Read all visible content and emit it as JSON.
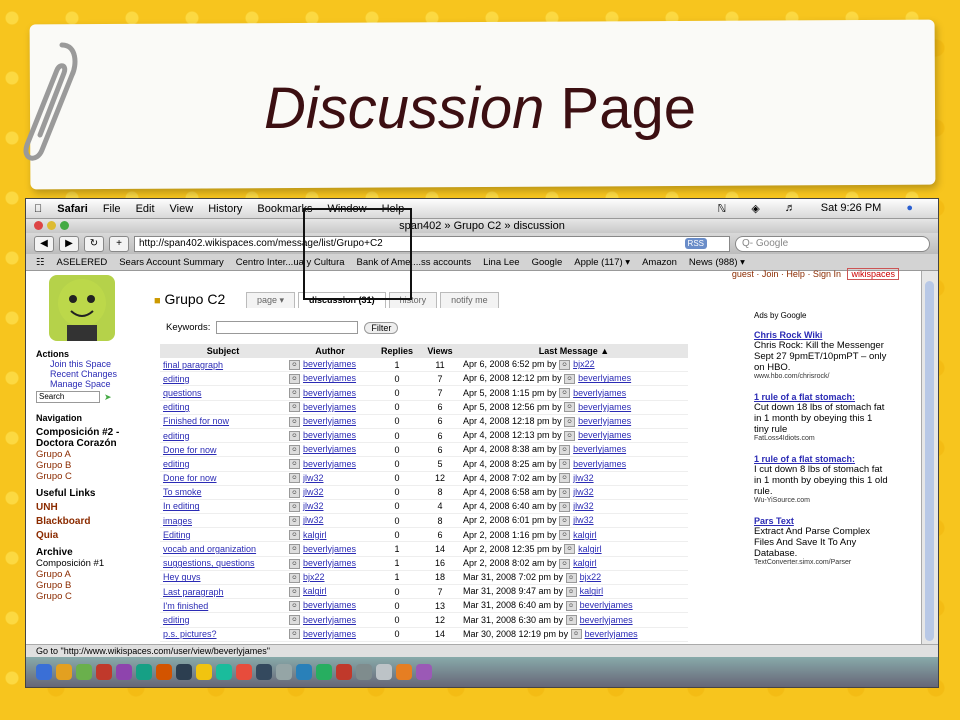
{
  "slide": {
    "title_italic": "Discussion",
    "title_plain": "Page"
  },
  "menubar": {
    "apple": "",
    "items": [
      "Safari",
      "File",
      "Edit",
      "View",
      "History",
      "Bookmarks",
      "Window",
      "Help"
    ],
    "clock": "Sat 9:26 PM"
  },
  "window": {
    "title": "span402 » Grupo C2 » discussion",
    "url": "http://span402.wikispaces.com/message/list/Grupo+C2",
    "rss": "RSS",
    "search_placeholder": "Q- Google"
  },
  "bookmarks": [
    "ASELERED",
    "Sears Account Summary",
    "Centro Inter...ua y Cultura",
    "Bank of Ame....ss accounts",
    "Lina Lee",
    "Google",
    "Apple (117) ▾",
    "Amazon",
    "News (988) ▾"
  ],
  "toplinks": "guest · Join · Help · Sign In",
  "wikispaces_badge": "wikispaces",
  "sidebar": {
    "actions_header": "Actions",
    "actions": [
      "Join this Space",
      "Recent Changes",
      "Manage Space"
    ],
    "search_placeholder": "Search",
    "navigation_header": "Navigation",
    "nav_title": "Composición #2 - Doctora Corazón",
    "nav_groups": [
      "Grupo A",
      "Grupo B",
      "Grupo C"
    ],
    "useful_links": "Useful Links",
    "links": [
      "UNH",
      "Blackboard",
      "Quia"
    ],
    "archive": "Archive",
    "archive_title": "Composición #1",
    "archive_groups": [
      "Grupo A",
      "Grupo B",
      "Grupo C"
    ]
  },
  "page": {
    "title": "Grupo C2",
    "tabs": [
      "page ▾",
      "discussion (31)",
      "history",
      "notify me"
    ],
    "keywords_label": "Keywords:",
    "filter_button": "Filter",
    "columns": [
      "Subject",
      "Author",
      "Replies",
      "Views",
      "Last Message ▲"
    ],
    "rows": [
      {
        "subject": "final paragraph",
        "author": "beverlyjames",
        "replies": "1",
        "views": "11",
        "date": "Apr 6, 2008 6:52 pm by",
        "by": "bjx22"
      },
      {
        "subject": "editing",
        "author": "beverlyjames",
        "replies": "0",
        "views": "7",
        "date": "Apr 6, 2008 12:12 pm by",
        "by": "beverlyjames"
      },
      {
        "subject": "questions",
        "author": "beverlyjames",
        "replies": "0",
        "views": "7",
        "date": "Apr 5, 2008 1:15 pm by",
        "by": "beverlyjames"
      },
      {
        "subject": "editing",
        "author": "beverlyjames",
        "replies": "0",
        "views": "6",
        "date": "Apr 5, 2008 12:56 pm by",
        "by": "beverlyjames"
      },
      {
        "subject": "Finished for now",
        "author": "beverlyjames",
        "replies": "0",
        "views": "6",
        "date": "Apr 4, 2008 12:18 pm by",
        "by": "beverlyjames"
      },
      {
        "subject": "editing",
        "author": "beverlyjames",
        "replies": "0",
        "views": "6",
        "date": "Apr 4, 2008 12:13 pm by",
        "by": "beverlyjames"
      },
      {
        "subject": "Done for now",
        "author": "beverlyjames",
        "replies": "0",
        "views": "6",
        "date": "Apr 4, 2008 8:38 am by",
        "by": "beverlyjames"
      },
      {
        "subject": "editing",
        "author": "beverlyjames",
        "replies": "0",
        "views": "5",
        "date": "Apr 4, 2008 8:25 am by",
        "by": "beverlyjames"
      },
      {
        "subject": "Done for now",
        "author": "jlw32",
        "replies": "0",
        "views": "12",
        "date": "Apr 4, 2008 7:02 am by",
        "by": "jlw32"
      },
      {
        "subject": "To smoke",
        "author": "jlw32",
        "replies": "0",
        "views": "8",
        "date": "Apr 4, 2008 6:58 am by",
        "by": "jlw32"
      },
      {
        "subject": "In editing",
        "author": "jlw32",
        "replies": "0",
        "views": "4",
        "date": "Apr 4, 2008 6:40 am by",
        "by": "jlw32"
      },
      {
        "subject": "images",
        "author": "jlw32",
        "replies": "0",
        "views": "8",
        "date": "Apr 2, 2008 6:01 pm by",
        "by": "jlw32"
      },
      {
        "subject": "Editing",
        "author": "kalgirl",
        "replies": "0",
        "views": "6",
        "date": "Apr 2, 2008 1:16 pm by",
        "by": "kalgirl"
      },
      {
        "subject": "vocab and organization",
        "author": "beverlyjames",
        "replies": "1",
        "views": "14",
        "date": "Apr 2, 2008 12:35 pm by",
        "by": "kalgirl"
      },
      {
        "subject": "suggestions, questions",
        "author": "beverlyjames",
        "replies": "1",
        "views": "16",
        "date": "Apr 2, 2008 8:02 am by",
        "by": "kalgirl"
      },
      {
        "subject": "Hey guys",
        "author": "bjx22",
        "replies": "1",
        "views": "18",
        "date": "Mar 31, 2008 7:02 pm by",
        "by": "bjx22"
      },
      {
        "subject": "Last paragraph",
        "author": "kalgirl",
        "replies": "0",
        "views": "7",
        "date": "Mar 31, 2008 9:47 am by",
        "by": "kalgirl"
      },
      {
        "subject": "I'm finished",
        "author": "beverlyjames",
        "replies": "0",
        "views": "13",
        "date": "Mar 31, 2008 6:40 am by",
        "by": "beverlyjames"
      },
      {
        "subject": "editing",
        "author": "beverlyjames",
        "replies": "0",
        "views": "12",
        "date": "Mar 31, 2008 6:30 am by",
        "by": "beverlyjames"
      },
      {
        "subject": "p.s. pictures?",
        "author": "beverlyjames",
        "replies": "0",
        "views": "14",
        "date": "Mar 30, 2008 12:19 pm by",
        "by": "beverlyjames"
      }
    ]
  },
  "ads": {
    "adsby": "Ads by Google",
    "items": [
      {
        "title": "Chris Rock Wiki",
        "desc": "Chris Rock: Kill the Messenger Sept 27 9pmET/10pmPT – only on HBO.",
        "url": "www.hbo.com/chrisrock/"
      },
      {
        "title": "1 rule of a flat stomach:",
        "desc": "Cut down 18 lbs of stomach fat in 1 month by obeying this 1 tiny rule",
        "url": "FatLoss4Idiots.com"
      },
      {
        "title": "1 rule of a flat stomach:",
        "desc": "I cut down 8 lbs of stomach fat in 1 month by obeying this 1 old rule.",
        "url": "Wu-YiSource.com"
      },
      {
        "title": "Pars Text",
        "desc": "Extract And Parse Complex Files And Save It To Any Database.",
        "url": "TextConverter.simx.com/Parser"
      }
    ]
  },
  "status": "Go to \"http://www.wikispaces.com/user/view/beverlyjames\""
}
